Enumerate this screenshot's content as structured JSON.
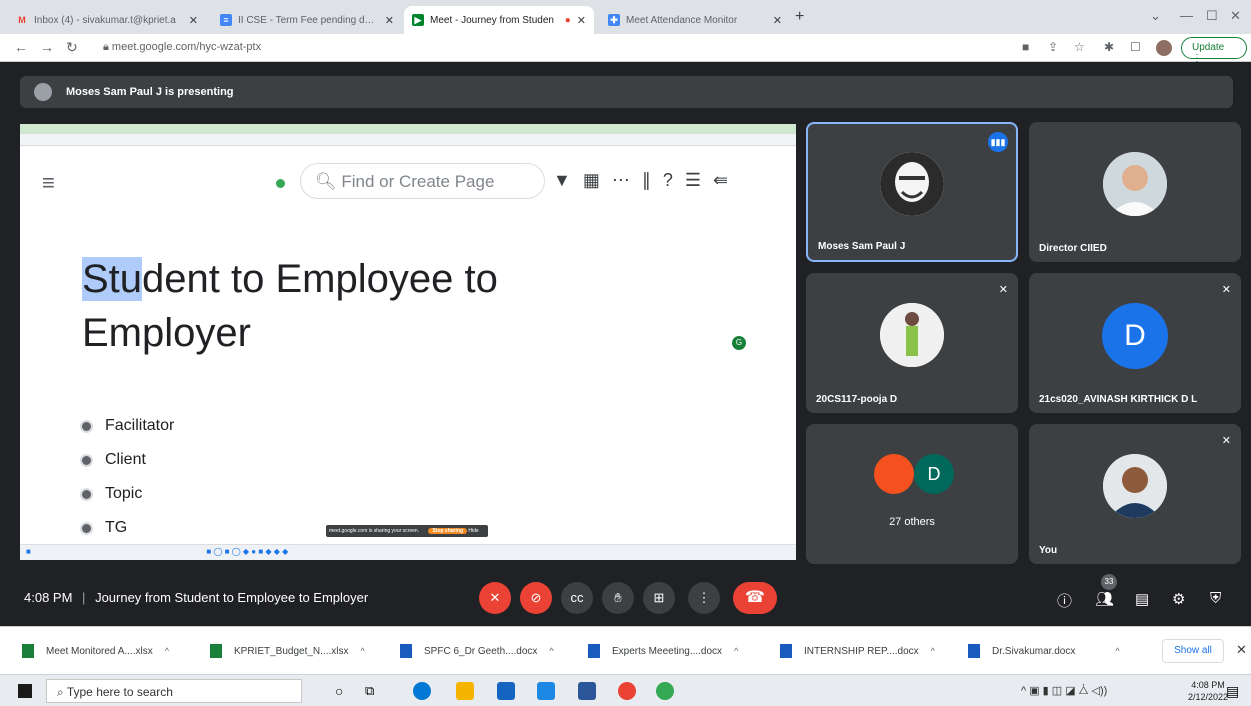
{
  "browser": {
    "tabs": [
      {
        "label": "Inbox (4) - sivakumar.t@kpriet.a",
        "fav": "M",
        "color": "#ea4335"
      },
      {
        "label": "II CSE - Term Fee pending detail",
        "fav": "≡",
        "color": "#4285f4"
      },
      {
        "label": "Meet - Journey from Studen",
        "fav": "▶",
        "color": "#00832d"
      },
      {
        "label": "Meet Attendance Monitor",
        "fav": "✚",
        "color": "#4285f4"
      }
    ],
    "url": "meet.google.com/hyc-wzat-ptx",
    "update_label": "Update"
  },
  "meet": {
    "presenting_text": "Moses Sam Paul J is presenting",
    "slide": {
      "search_placeholder": "Find or Create Page",
      "title_highlight": "Stu",
      "title_rest": "dent to Employee to Employer",
      "bullets": [
        "Facilitator",
        "Client",
        "Topic",
        "TG"
      ],
      "toast_text": "meet.google.com is sharing your screen.",
      "toast_button": "Stop sharing",
      "toast_hide": "Hide"
    },
    "participants": [
      {
        "name": "Moses Sam Paul J",
        "speaking": true
      },
      {
        "name": "Director CIIED",
        "muted": false
      },
      {
        "name": "20CS117-pooja D",
        "muted": true
      },
      {
        "name": "21cs020_AVINASH KIRTHICK D L",
        "muted": true,
        "initial": "D"
      },
      {
        "others_label": "27 others",
        "initial": "D"
      },
      {
        "name": "You",
        "muted": true
      }
    ],
    "time": "4:08 PM",
    "meeting_title": "Journey from Student to Employee to Employer",
    "participant_count": "33"
  },
  "downloads": [
    {
      "name": "Meet Monitored A....xlsx",
      "type": "xlsx"
    },
    {
      "name": "KPRIET_Budget_N....xlsx",
      "type": "xlsx"
    },
    {
      "name": "SPFC 6_Dr Geeth....docx",
      "type": "docx"
    },
    {
      "name": "Experts Meeeting....docx",
      "type": "docx"
    },
    {
      "name": "INTERNSHIP REP....docx",
      "type": "docx"
    },
    {
      "name": "Dr.Sivakumar.docx",
      "type": "docx"
    }
  ],
  "show_all_label": "Show all",
  "taskbar": {
    "search_placeholder": "Type here to search",
    "time": "4:08 PM",
    "date": "2/12/2022"
  }
}
